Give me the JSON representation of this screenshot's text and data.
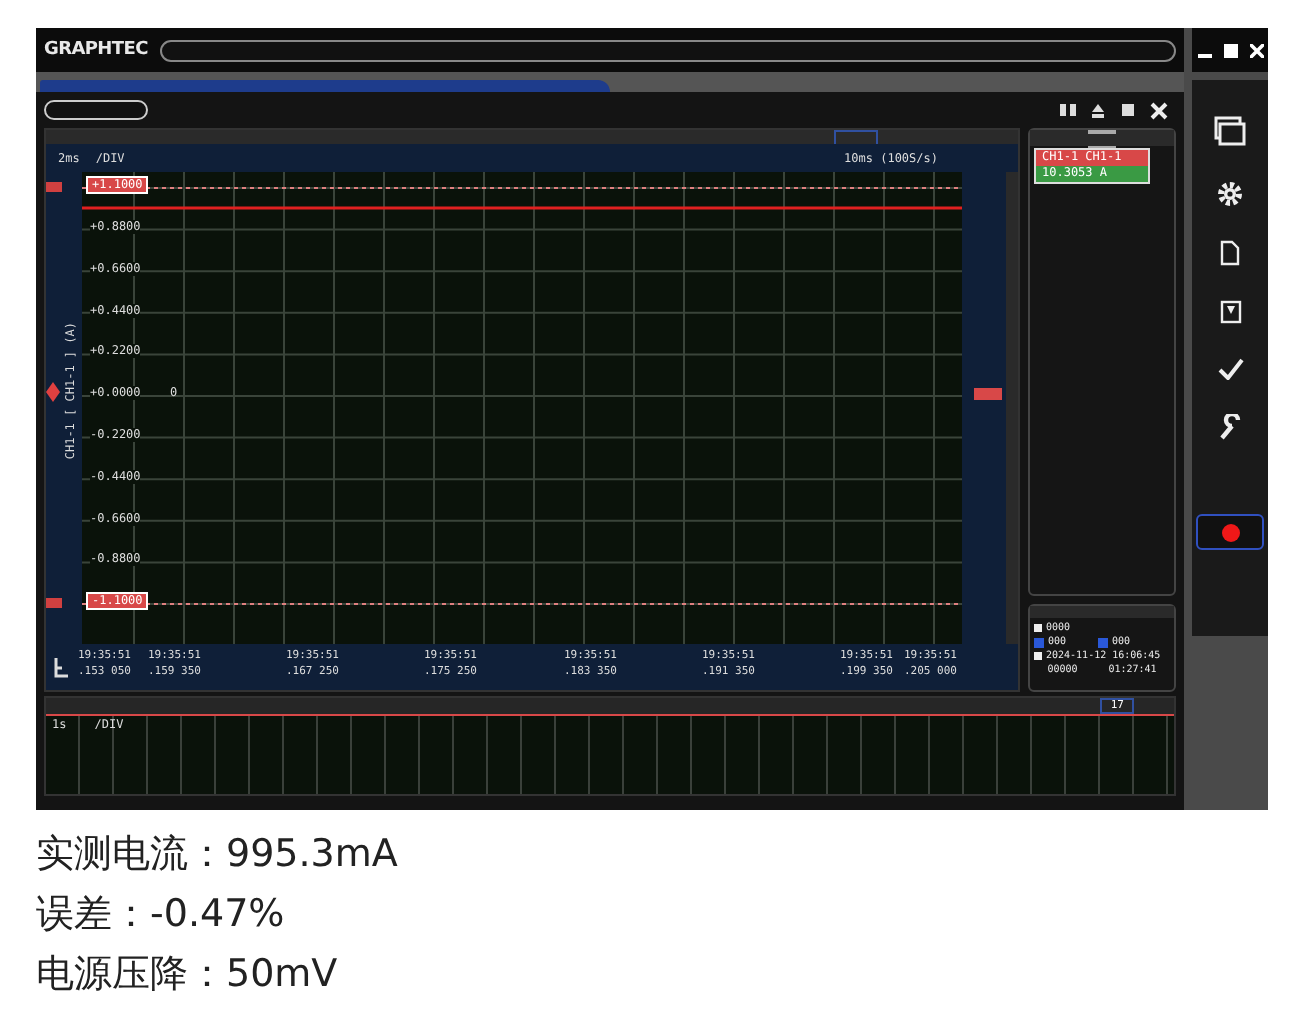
{
  "app": {
    "logo": "GRAPHTEC"
  },
  "chart": {
    "time_div": "2ms",
    "div_unit": "/DIV",
    "sample": "10ms (100S/s)",
    "axis_title": "CH1-1 [ CH1-1 ] (A)",
    "upper_limit": "+1.1000",
    "lower_limit": "-1.1000",
    "zero_mark": "0",
    "y_labels": [
      "+0.8800",
      "+0.6600",
      "+0.4400",
      "+0.2200",
      "+0.0000",
      "-0.2200",
      "-0.4400",
      "-0.6600",
      "-0.8800"
    ],
    "time_labels": [
      {
        "time": "19:35:51",
        "frac": ".153 050"
      },
      {
        "time": "19:35:51",
        "frac": ".159 350"
      },
      {
        "time": "19:35:51",
        "frac": ".167 250"
      },
      {
        "time": "19:35:51",
        "frac": ".175 250"
      },
      {
        "time": "19:35:51",
        "frac": ".183 350"
      },
      {
        "time": "19:35:51",
        "frac": ".191 350"
      },
      {
        "time": "19:35:51",
        "frac": ".199 350"
      },
      {
        "time": "19:35:51",
        "frac": ".205 000"
      }
    ]
  },
  "channel_panel": {
    "channel": "CH1-1 CH1-1",
    "reading": "10.3053 A"
  },
  "status_panel": {
    "count": "0000",
    "value_a": "000",
    "value_b": "000",
    "datetime": "2024-11-12 16:06:45",
    "mode": "00000",
    "elapsed": "01:27:41"
  },
  "overview": {
    "time_div": "1s",
    "div_unit": "/DIV",
    "page": "17"
  },
  "results": [
    "实测电流：995.3mA",
    "误差：-0.47%",
    "电源压降：50mV"
  ]
}
